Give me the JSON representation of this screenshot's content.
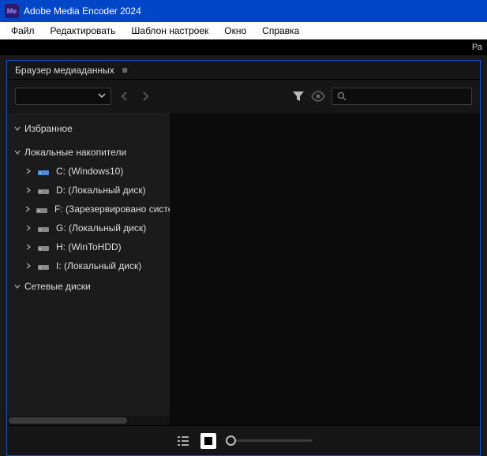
{
  "titlebar": {
    "icon_text": "Me",
    "title": "Adobe Media Encoder 2024"
  },
  "menubar": {
    "file": "Файл",
    "edit": "Редактировать",
    "presets": "Шаблон настроек",
    "window": "Окно",
    "help": "Справка"
  },
  "strip": {
    "right": "Ра"
  },
  "panel": {
    "title": "Браузер медиаданных"
  },
  "search": {
    "placeholder": ""
  },
  "tree": {
    "favorites": "Избранное",
    "local": "Локальные накопители",
    "drives": [
      "C: (Windows10)",
      "D: (Локальный диск)",
      "F: (Зарезервировано системой)",
      "G: (Локальный диск)",
      "H: (WinToHDD)",
      "I: (Локальный диск)"
    ],
    "network": "Сетевые диски"
  }
}
